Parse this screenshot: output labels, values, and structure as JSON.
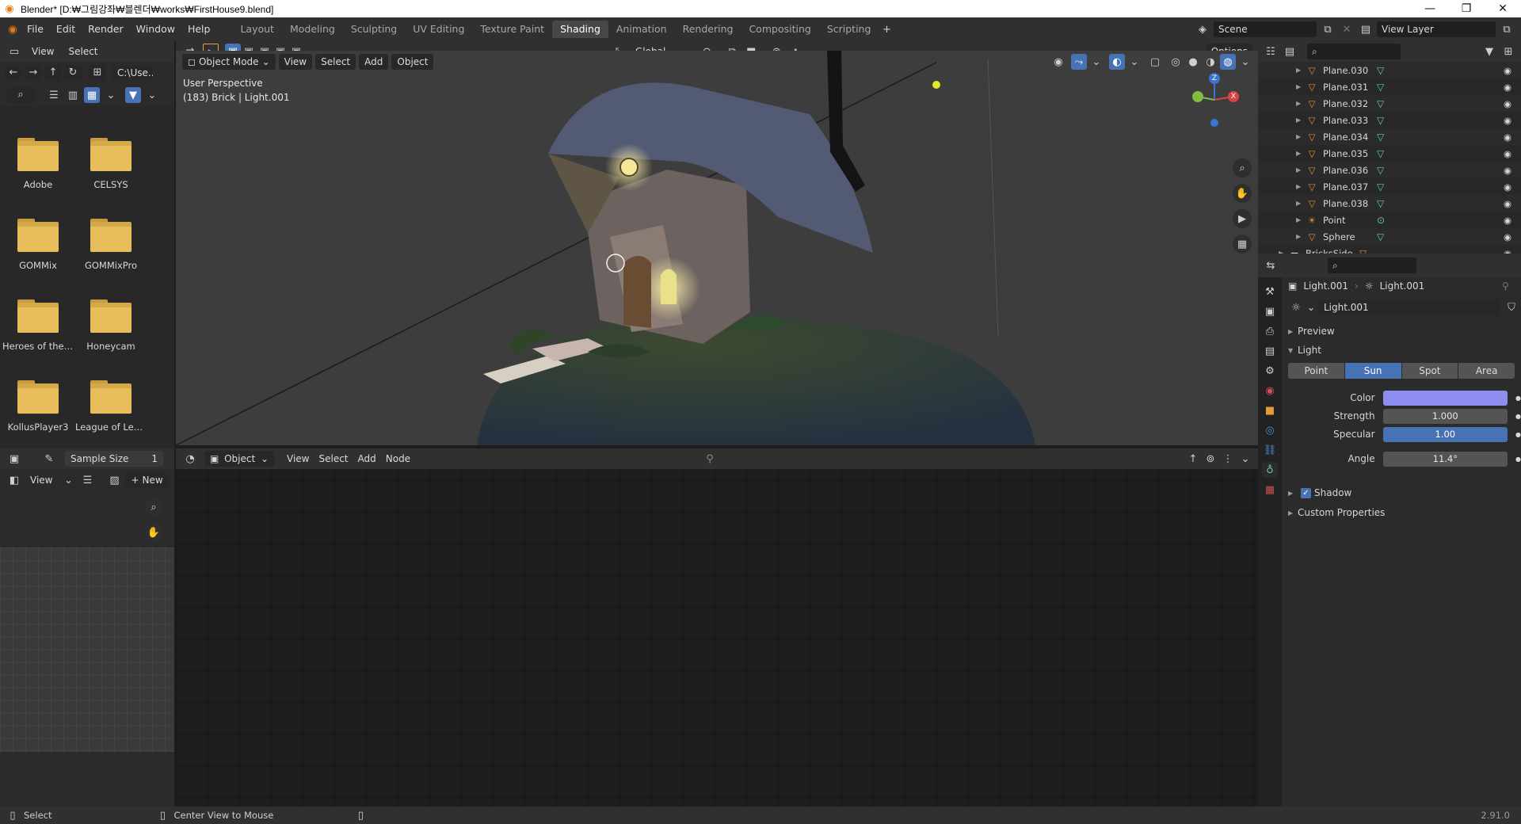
{
  "window": {
    "title": "Blender* [D:₩그림강좌₩블렌더₩works₩FirstHouse9.blend]",
    "minimize": "—",
    "restore": "❐",
    "close": "✕"
  },
  "menu": [
    "File",
    "Edit",
    "Render",
    "Window",
    "Help"
  ],
  "workspaces": [
    "Layout",
    "Modeling",
    "Sculpting",
    "UV Editing",
    "Texture Paint",
    "Shading",
    "Animation",
    "Rendering",
    "Compositing",
    "Scripting"
  ],
  "active_workspace": "Shading",
  "scene": {
    "name": "Scene",
    "view_layer": "View Layer"
  },
  "filebrowser": {
    "view": "View",
    "select": "Select",
    "path": "C:\\Use...",
    "folders": [
      "Adobe",
      "CELSYS",
      "GOMMix",
      "GOMMixPro",
      "Heroes of the ...",
      "Honeycam",
      "KollusPlayer3",
      "League of Leg..."
    ]
  },
  "viewport": {
    "mode": "Object Mode",
    "menus": [
      "View",
      "Select",
      "Add",
      "Object"
    ],
    "orientation": "Global",
    "options": "Options",
    "perspective_label": "User Perspective",
    "object_info": "(183) Brick | Light.001",
    "gizmo": {
      "x": "X",
      "y": "Y",
      "z": "Z"
    }
  },
  "imgeditor": {
    "sample_size_label": "Sample Size",
    "sample_size_value": "1",
    "view": "View",
    "new": "New"
  },
  "nodeeditor": {
    "type": "Object",
    "menus": [
      "View",
      "Select",
      "Add",
      "Node"
    ]
  },
  "outliner": {
    "items": [
      {
        "name": "Plane.030",
        "kind": "mesh"
      },
      {
        "name": "Plane.031",
        "kind": "mesh"
      },
      {
        "name": "Plane.032",
        "kind": "mesh"
      },
      {
        "name": "Plane.033",
        "kind": "mesh"
      },
      {
        "name": "Plane.034",
        "kind": "mesh"
      },
      {
        "name": "Plane.035",
        "kind": "mesh"
      },
      {
        "name": "Plane.036",
        "kind": "mesh"
      },
      {
        "name": "Plane.037",
        "kind": "mesh"
      },
      {
        "name": "Plane.038",
        "kind": "mesh"
      },
      {
        "name": "Point",
        "kind": "light"
      },
      {
        "name": "Sphere",
        "kind": "mesh"
      },
      {
        "name": "BricksSide",
        "kind": "collection"
      }
    ]
  },
  "properties": {
    "breadcrumb_object": "Light.001",
    "breadcrumb_data": "Light.001",
    "datablock": "Light.001",
    "sections": {
      "preview": "Preview",
      "light": "Light",
      "shadow": "Shadow",
      "custom": "Custom Properties"
    },
    "light_types": [
      "Point",
      "Sun",
      "Spot",
      "Area"
    ],
    "active_light_type": "Sun",
    "color_label": "Color",
    "color_value": "#8d8ef0",
    "strength_label": "Strength",
    "strength_value": "1.000",
    "specular_label": "Specular",
    "specular_value": "1.00",
    "angle_label": "Angle",
    "angle_value": "11.4°",
    "shadow_enabled": true
  },
  "statusbar": {
    "left": "Select",
    "middle": "Center View to Mouse",
    "version": "2.91.0"
  }
}
